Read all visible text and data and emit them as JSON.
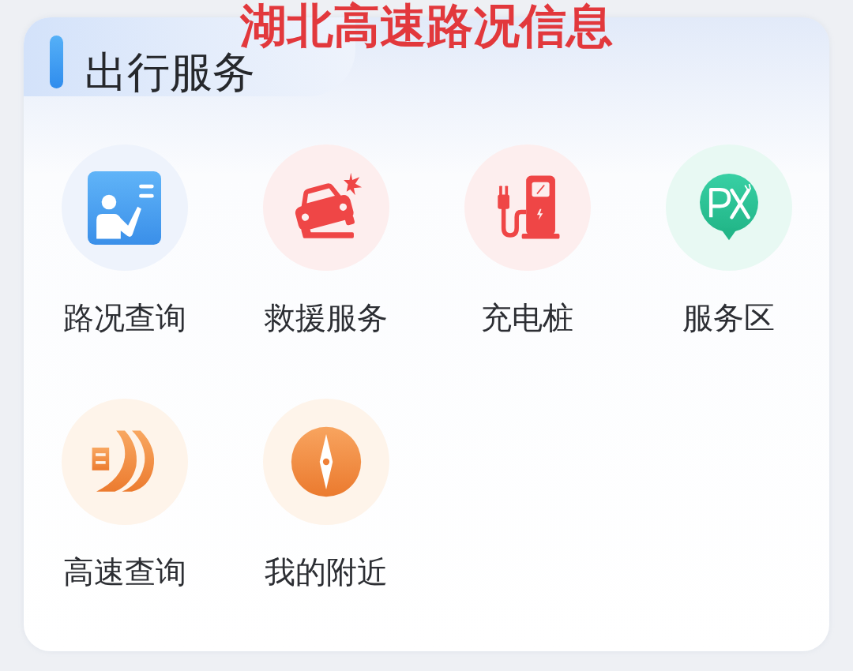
{
  "caption": "湖北高速路况信息",
  "section": {
    "title": "出行服务"
  },
  "services": [
    {
      "label": "路况查询"
    },
    {
      "label": "救援服务"
    },
    {
      "label": "充电桩"
    },
    {
      "label": "服务区"
    },
    {
      "label": "高速查询"
    },
    {
      "label": "我的附近"
    }
  ]
}
